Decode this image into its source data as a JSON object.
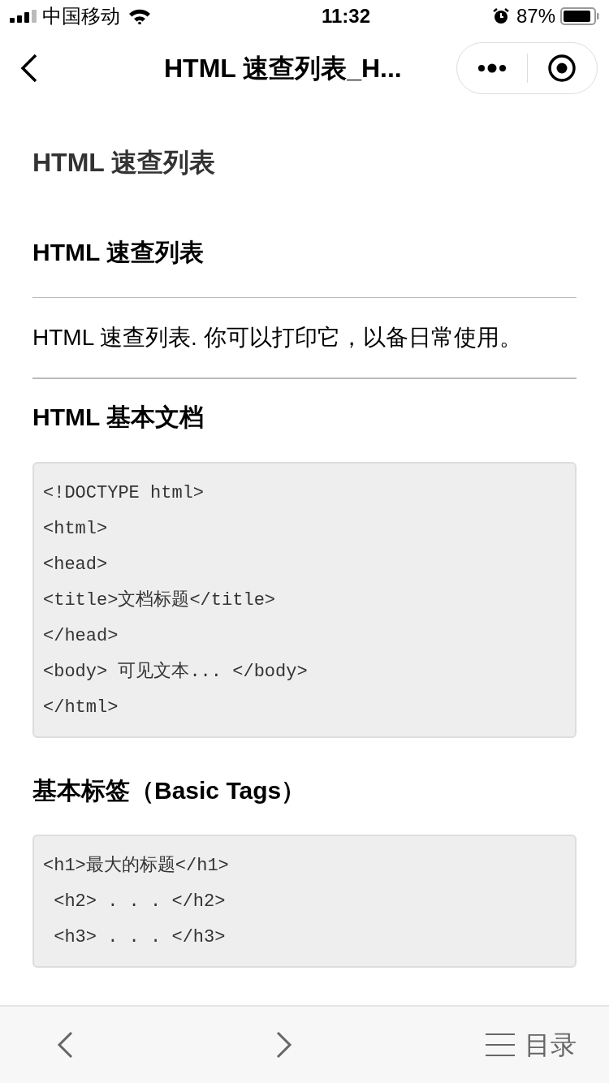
{
  "status_bar": {
    "carrier": "中国移动",
    "time": "11:32",
    "battery": "87%"
  },
  "nav_bar": {
    "title": "HTML 速查列表_H..."
  },
  "content": [
    {
      "kind": "title",
      "text": "HTML 速查列表"
    },
    {
      "kind": "heading",
      "text": "HTML 速查列表"
    },
    {
      "kind": "rule"
    },
    {
      "kind": "paragraph",
      "text": "HTML 速查列表. 你可以打印它，以备日常使用。"
    },
    {
      "kind": "rule"
    },
    {
      "kind": "heading",
      "text": "HTML 基本文档"
    },
    {
      "kind": "code",
      "lines": [
        "<!DOCTYPE html>",
        "<html>",
        "<head>",
        "<title>文档标题</title>",
        "</head>",
        "<body> 可见文本... </body>",
        "</html>"
      ]
    },
    {
      "kind": "heading",
      "text": "基本标签（Basic Tags）"
    },
    {
      "kind": "code",
      "lines": [
        "<h1>最大的标题</h1>",
        " <h2> . . . </h2>",
        " <h3> . . . </h3>"
      ]
    }
  ],
  "bottom_bar": {
    "menu_label": "目录"
  }
}
